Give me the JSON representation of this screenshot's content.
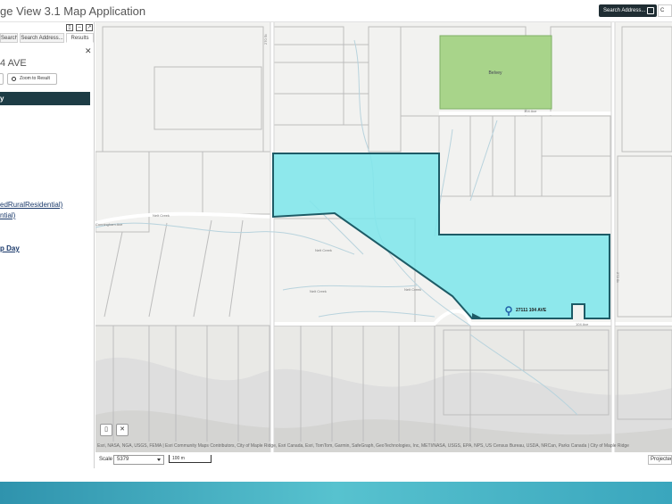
{
  "app": {
    "title": "ge View 3.1 Map Application"
  },
  "toolbar": {
    "search_address_label": "Search Address...",
    "extra_btn_label": "C"
  },
  "panel": {
    "tabs": [
      {
        "label": "Search"
      },
      {
        "label": "Search Address..."
      },
      {
        "label": "Results"
      }
    ],
    "address_heading": "4 AVE",
    "zoom_button_label": "Zoom to Result",
    "section_header": "y",
    "zoning_link": "edRuralResidential)",
    "zoning_link2": "ntial)",
    "collection_day": "p Day"
  },
  "map": {
    "labels": {
      "park": "Belvey",
      "road_north": "104 Ave",
      "road_south": "104 Ave",
      "street_west": "270 St",
      "street_east": "272 St",
      "creek1": "Nelt Creek",
      "creek2": "Nelt Creek",
      "creek3": "Nelt Creek",
      "creek4": "Nelt Creek",
      "road_west": "Cunningham Ave",
      "address_marker": "27111 104 AVE"
    },
    "parcel_color": "#7fe6ea",
    "park_color": "#a8d48a",
    "attribution": "Esri, NASA, NGA, USGS, FEMA | Esri Community Maps Contributors, City of Maple Ridge, Esri Canada, Esri, TomTom, Garmin, SafeGraph, GeoTechnologies, Inc, METI/NASA, USGS, EPA, NPS, US Census Bureau, USDA, NRCan, Parks Canada | City of Maple Ridge",
    "scale_label": "Scale",
    "scale_value": "5379",
    "scalebar_label": "100 m",
    "projection_label": "Projected"
  }
}
